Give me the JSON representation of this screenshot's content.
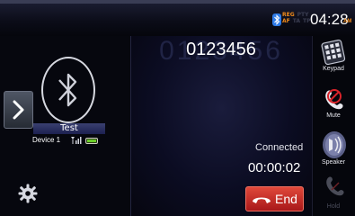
{
  "status_bar": {
    "flags_row1": [
      "REG",
      "PTY"
    ],
    "flags_row2": [
      "AF",
      "TA",
      "TP"
    ],
    "time": "04:28",
    "ampm": "AM"
  },
  "left_panel": {
    "device_name": "Test",
    "device_label": "Device 1"
  },
  "call": {
    "ghost_number": "0123456",
    "number": "0123456",
    "status": "Connected",
    "duration": "00:00:02",
    "end_label": "End"
  },
  "right_buttons": {
    "keypad": "Keypad",
    "mute": "Mute",
    "speaker": "Speaker",
    "hold": "Hold"
  },
  "colors": {
    "accent_orange": "#f08a1a",
    "end_red": "#c8201e",
    "bluetooth_blue": "#2f7be6"
  }
}
